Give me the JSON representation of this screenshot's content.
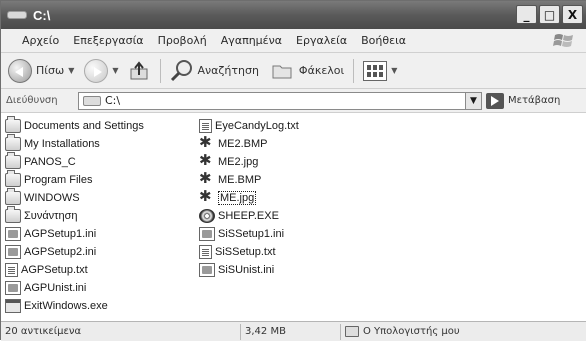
{
  "window": {
    "title": "C:\\",
    "controls": {
      "minimize": "_",
      "maximize": "□",
      "close": "X"
    }
  },
  "menubar": {
    "items": [
      "Αρχείο",
      "Επεξεργασία",
      "Προβολή",
      "Αγαπημένα",
      "Εργαλεία",
      "Βοήθεια"
    ]
  },
  "toolbar": {
    "back_label": "Πίσω",
    "search_label": "Αναζήτηση",
    "folders_label": "Φάκελοι"
  },
  "addressbar": {
    "label": "Διεύθυνση",
    "value": "C:\\",
    "go_label": "Μετάβαση"
  },
  "files": {
    "col1": [
      {
        "name": "Documents and Settings",
        "icon": "folder-icon"
      },
      {
        "name": "My Installations",
        "icon": "folder-icon"
      },
      {
        "name": "PANOS_C",
        "icon": "folder-icon"
      },
      {
        "name": "Program Files",
        "icon": "folder-icon"
      },
      {
        "name": "WINDOWS",
        "icon": "folder-icon"
      },
      {
        "name": "Συνάντηση",
        "icon": "folder-icon"
      },
      {
        "name": "AGPSetup1.ini",
        "icon": "ini-file-icon"
      },
      {
        "name": "AGPSetup2.ini",
        "icon": "ini-file-icon"
      },
      {
        "name": "AGPSetup.txt",
        "icon": "text-file-icon"
      },
      {
        "name": "AGPUnist.ini",
        "icon": "ini-file-icon"
      },
      {
        "name": "ExitWindows.exe",
        "icon": "exe-file-icon"
      }
    ],
    "col2": [
      {
        "name": "EyeCandyLog.txt",
        "icon": "text-file-icon"
      },
      {
        "name": "ME2.BMP",
        "icon": "image-file-icon"
      },
      {
        "name": "ME2.jpg",
        "icon": "image-file-icon"
      },
      {
        "name": "ME.BMP",
        "icon": "image-file-icon"
      },
      {
        "name": "ME.jpg",
        "icon": "image-file-icon",
        "selected": true
      },
      {
        "name": "SHEEP.EXE",
        "icon": "sheep-exe-icon"
      },
      {
        "name": "SiSSetup1.ini",
        "icon": "ini-file-icon"
      },
      {
        "name": "SiSSetup.txt",
        "icon": "text-file-icon"
      },
      {
        "name": "SiSUnist.ini",
        "icon": "ini-file-icon"
      }
    ]
  },
  "statusbar": {
    "count": "20 αντικείμενα",
    "size": "3,42 MB",
    "location": "Ο Υπολογιστής μου"
  }
}
